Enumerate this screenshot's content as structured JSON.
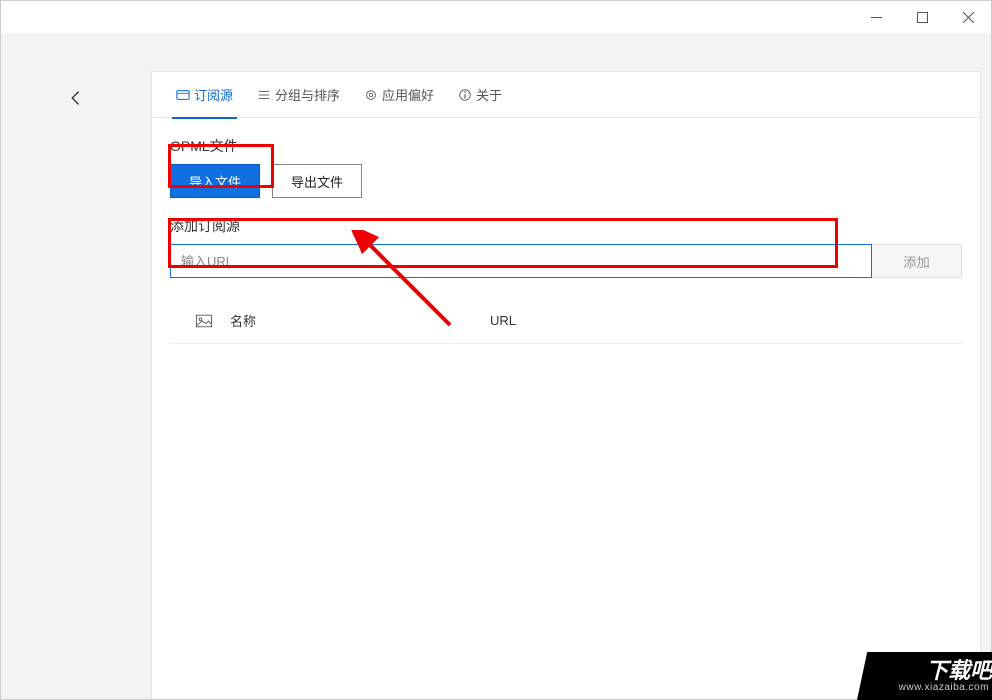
{
  "titlebar": {
    "min": "minimize",
    "max": "maximize",
    "close": "close"
  },
  "tabs": {
    "subscriptions": "订阅源",
    "grouping": "分组与排序",
    "preferences": "应用偏好",
    "about": "关于"
  },
  "opml": {
    "label": "OPML文件",
    "import": "导入文件",
    "export": "导出文件"
  },
  "add_feed": {
    "label": "添加订阅源",
    "placeholder": "输入URL",
    "value": "",
    "add_button": "添加"
  },
  "table": {
    "col_name": "名称",
    "col_url": "URL"
  },
  "watermark": {
    "big": "下载吧",
    "small": "www.xiazaiba.com"
  }
}
